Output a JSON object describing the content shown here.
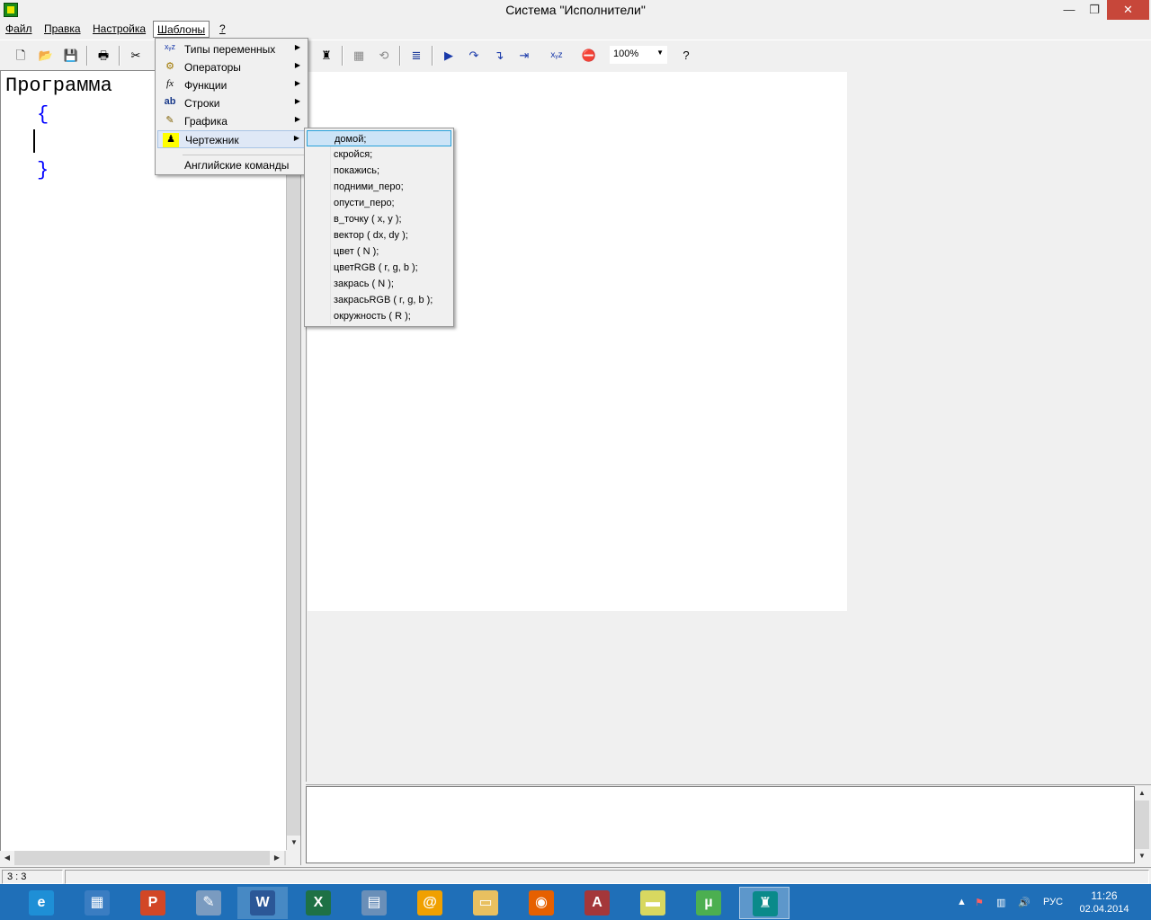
{
  "window": {
    "title": "Система \"Исполнители\"",
    "minimize": "—",
    "maximize": "❐",
    "close": "✕"
  },
  "menubar": {
    "items": [
      {
        "label": "Файл"
      },
      {
        "label": "Правка"
      },
      {
        "label": "Настройка"
      },
      {
        "label": "Шаблоны"
      },
      {
        "label": "?"
      }
    ]
  },
  "toolbar": {
    "zoom": "100%",
    "icons": [
      "new-file-icon",
      "open-folder-icon",
      "save-icon",
      "print-icon",
      "cut-icon",
      "drawer-icon",
      "grid-icon",
      "refresh-icon",
      "align-icon",
      "run-icon",
      "step-icon",
      "step-into-icon",
      "step-cursor-icon",
      "variables-icon",
      "stop-icon",
      "help-icon"
    ]
  },
  "editor": {
    "line1": "Программа",
    "line2": "{",
    "line4": "}"
  },
  "templates_menu": {
    "items": [
      {
        "label": "Типы переменных",
        "icon": "variables-icon",
        "glyph": "xᵧz",
        "submenu": true
      },
      {
        "label": "Операторы",
        "icon": "gears-icon",
        "glyph": "⚙",
        "submenu": true
      },
      {
        "label": "Функции",
        "icon": "function-icon",
        "glyph": "fx",
        "submenu": true
      },
      {
        "label": "Строки",
        "icon": "strings-icon",
        "glyph": "ab",
        "submenu": true
      },
      {
        "label": "Графика",
        "icon": "brush-icon",
        "glyph": "✎",
        "submenu": true
      },
      {
        "label": "Чертежник",
        "icon": "drawer-icon",
        "glyph": "♟",
        "submenu": true
      },
      {
        "label": "Английские команды",
        "submenu": false
      }
    ]
  },
  "drawer_menu": {
    "items": [
      "домой;",
      "скройся;",
      "покажись;",
      "подними_перо;",
      "опусти_перо;",
      "в_точку ( x, y );",
      "вектор ( dx, dy );",
      "цвет ( N );",
      "цветRGB ( r, g, b );",
      "закрась ( N );",
      "закрасьRGB ( r, g, b );",
      "окружность ( R );"
    ]
  },
  "statusbar": {
    "position": "3 : 3",
    "message": ""
  },
  "taskbar": {
    "apps": [
      {
        "name": "internet-explorer-icon",
        "glyph": "e",
        "color": "#1e8fd6"
      },
      {
        "name": "remote-desktop-icon",
        "glyph": "▦",
        "color": "#3a7dc2"
      },
      {
        "name": "powerpoint-icon",
        "glyph": "P",
        "color": "#d24726"
      },
      {
        "name": "paint-icon",
        "glyph": "✎",
        "color": "#7a9bc0"
      },
      {
        "name": "word-icon",
        "glyph": "W",
        "color": "#2b5797"
      },
      {
        "name": "excel-icon",
        "glyph": "X",
        "color": "#1e7145"
      },
      {
        "name": "calculator-icon",
        "glyph": "▤",
        "color": "#6a8fb8"
      },
      {
        "name": "mail-agent-icon",
        "glyph": "@",
        "color": "#f0a000"
      },
      {
        "name": "file-explorer-icon",
        "glyph": "▭",
        "color": "#e8c060"
      },
      {
        "name": "firefox-icon",
        "glyph": "◉",
        "color": "#e66000"
      },
      {
        "name": "access-icon",
        "glyph": "A",
        "color": "#a4373a"
      },
      {
        "name": "sticky-notes-icon",
        "glyph": "▬",
        "color": "#d8d860"
      },
      {
        "name": "utorrent-icon",
        "glyph": "µ",
        "color": "#4caf50"
      },
      {
        "name": "executors-app-icon",
        "glyph": "♜",
        "color": "#0a8a8a"
      }
    ],
    "lang": "РУС",
    "time": "11:26",
    "date": "02.04.2014"
  }
}
